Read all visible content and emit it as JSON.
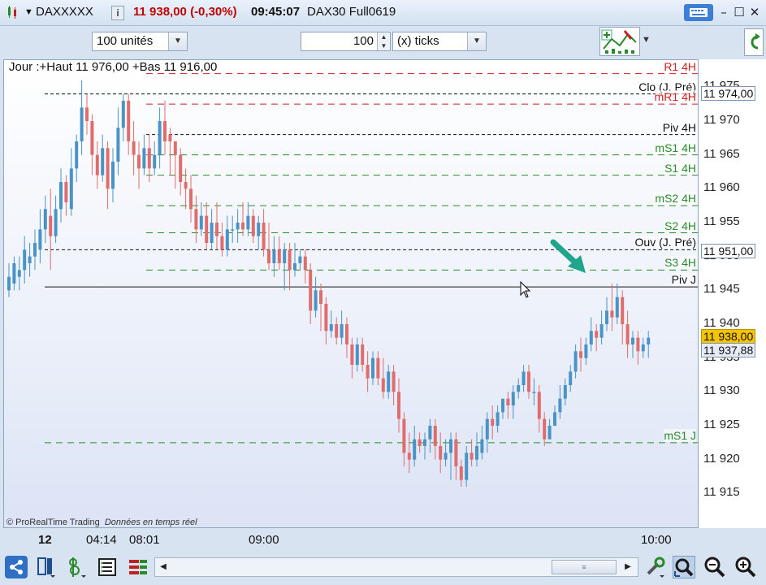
{
  "titlebar": {
    "ticker": "DAXXXXX",
    "info_icon": "info-icon",
    "price_change": "11 938,00 (-0,30%)",
    "time": "09:45:07",
    "contract": "DAX30 Full0619"
  },
  "toolbar": {
    "units_value": "100 unités",
    "quantity_value": "100",
    "ticks_value": "(x) ticks"
  },
  "chart": {
    "header": "Jour :+Haut 11 976,00 +Bas 11 916,00",
    "watermark_brand": "© ProRealTime Trading",
    "watermark_note": "Données en temps réel",
    "levels": [
      {
        "label": "R1 4H",
        "price": 11977.0,
        "color": "#d02020"
      },
      {
        "label": "Clo (J. Pré)",
        "price": 11974.0,
        "color": "#111111"
      },
      {
        "label": "mR1 4H",
        "price": 11972.5,
        "color": "#d02020"
      },
      {
        "label": "Piv 4H",
        "price": 11968.0,
        "color": "#111111"
      },
      {
        "label": "mS1 4H",
        "price": 11965.0,
        "color": "#2a8a2a"
      },
      {
        "label": "S1 4H",
        "price": 11962.0,
        "color": "#2a8a2a"
      },
      {
        "label": "mS2 4H",
        "price": 11957.5,
        "color": "#2a8a2a"
      },
      {
        "label": "S2 4H",
        "price": 11953.5,
        "color": "#2a8a2a"
      },
      {
        "label": "Ouv (J. Pré)",
        "price": 11951.0,
        "color": "#111111"
      },
      {
        "label": "S3 4H",
        "price": 11948.0,
        "color": "#2a8a2a"
      },
      {
        "label": "Piv J",
        "price": 11945.5,
        "color": "#111111"
      },
      {
        "label": "mS1 J",
        "price": 11922.5,
        "color": "#2a8a2a"
      }
    ]
  },
  "chart_data": {
    "type": "candlestick",
    "ylim": [
      11910,
      11979
    ],
    "yticks": [
      "11 975",
      "11 970",
      "11 965",
      "11 960",
      "11 955",
      "11 950",
      "11 945",
      "11 940",
      "11 935",
      "11 930",
      "11 925",
      "11 920",
      "11 915"
    ],
    "xticks": [
      "12",
      "04:14",
      "08:01",
      "09:00",
      "10:00"
    ],
    "candles": [
      [
        11945,
        11947,
        11944,
        11949
      ],
      [
        11946,
        11949,
        11945,
        11950
      ],
      [
        11947,
        11948,
        11945,
        11950
      ],
      [
        11948,
        11951,
        11946,
        11953
      ],
      [
        11949,
        11950,
        11947,
        11952
      ],
      [
        11950,
        11952,
        11948,
        11954
      ],
      [
        11951,
        11954,
        11949,
        11957
      ],
      [
        11954,
        11957,
        11952,
        11959
      ],
      [
        11956,
        11953,
        11948,
        11960
      ],
      [
        11953,
        11957,
        11952,
        11959
      ],
      [
        11957,
        11961,
        11955,
        11963
      ],
      [
        11961,
        11958,
        11956,
        11962
      ],
      [
        11957,
        11963,
        11956,
        11966
      ],
      [
        11963,
        11967,
        11961,
        11968
      ],
      [
        11967,
        11972,
        11965,
        11976
      ],
      [
        11972,
        11970,
        11968,
        11974
      ],
      [
        11970,
        11965,
        11962,
        11971
      ],
      [
        11965,
        11962,
        11960,
        11967
      ],
      [
        11962,
        11966,
        11961,
        11968
      ],
      [
        11966,
        11960,
        11957,
        11967
      ],
      [
        11960,
        11964,
        11958,
        11966
      ],
      [
        11964,
        11969,
        11962,
        11972
      ],
      [
        11969,
        11973,
        11967,
        11974
      ],
      [
        11973,
        11967,
        11965,
        11974
      ],
      [
        11967,
        11965,
        11962,
        11970
      ],
      [
        11965,
        11963,
        11960,
        11967
      ],
      [
        11963,
        11966,
        11962,
        11968
      ],
      [
        11966,
        11963,
        11961,
        11968
      ],
      [
        11963,
        11965,
        11962,
        11967
      ],
      [
        11965,
        11970,
        11963,
        11972
      ],
      [
        11970,
        11967,
        11965,
        11973
      ],
      [
        11968,
        11967,
        11962,
        11969
      ],
      [
        11967,
        11965,
        11960,
        11967
      ],
      [
        11965,
        11961,
        11959,
        11966
      ],
      [
        11961,
        11960,
        11957,
        11963
      ],
      [
        11960,
        11957,
        11955,
        11962
      ],
      [
        11957,
        11954,
        11952,
        11959
      ],
      [
        11954,
        11956,
        11953,
        11958
      ],
      [
        11956,
        11952,
        11951,
        11958
      ],
      [
        11952,
        11955,
        11951,
        11957
      ],
      [
        11955,
        11953,
        11951,
        11958
      ],
      [
        11953,
        11951,
        11950,
        11955
      ],
      [
        11951,
        11954,
        11950,
        11956
      ],
      [
        11954,
        11954,
        11952,
        11956
      ],
      [
        11954,
        11955,
        11952,
        11957
      ],
      [
        11955,
        11954,
        11953,
        11958
      ],
      [
        11954,
        11956,
        11953,
        11958
      ],
      [
        11956,
        11953,
        11952,
        11957
      ],
      [
        11953,
        11955,
        11951,
        11956
      ],
      [
        11955,
        11951,
        11950,
        11957
      ],
      [
        11951,
        11949,
        11948,
        11955
      ],
      [
        11949,
        11951,
        11947,
        11953
      ],
      [
        11951,
        11949,
        11948,
        11953
      ],
      [
        11949,
        11951,
        11945,
        11952
      ],
      [
        11951,
        11948,
        11945,
        11952
      ],
      [
        11948,
        11949,
        11947,
        11952
      ],
      [
        11949,
        11950,
        11948,
        11951
      ],
      [
        11950,
        11948,
        11946,
        11951
      ],
      [
        11948,
        11942,
        11940,
        11949
      ],
      [
        11942,
        11945,
        11941,
        11947
      ],
      [
        11945,
        11943,
        11939,
        11946
      ],
      [
        11943,
        11939,
        11937,
        11944
      ],
      [
        11939,
        11940,
        11938,
        11942
      ],
      [
        11940,
        11938,
        11937,
        11941
      ],
      [
        11938,
        11940,
        11937,
        11942
      ],
      [
        11940,
        11937,
        11935,
        11941
      ],
      [
        11937,
        11934,
        11932,
        11938
      ],
      [
        11934,
        11937,
        11933,
        11938
      ],
      [
        11937,
        11934,
        11933,
        11938
      ],
      [
        11934,
        11932,
        11930,
        11936
      ],
      [
        11932,
        11935,
        11931,
        11936
      ],
      [
        11935,
        11932,
        11931,
        11936
      ],
      [
        11932,
        11930,
        11929,
        11935
      ],
      [
        11930,
        11933,
        11929,
        11934
      ],
      [
        11933,
        11930,
        11928,
        11934
      ],
      [
        11930,
        11926,
        11924,
        11932
      ],
      [
        11926,
        11921,
        11919,
        11927
      ],
      [
        11921,
        11920,
        11918,
        11924
      ],
      [
        11920,
        11923,
        11919,
        11925
      ],
      [
        11923,
        11922,
        11921,
        11924
      ],
      [
        11922,
        11923,
        11920,
        11924
      ],
      [
        11923,
        11925,
        11921,
        11926
      ],
      [
        11925,
        11922,
        11920,
        11926
      ],
      [
        11922,
        11920,
        11918,
        11924
      ],
      [
        11920,
        11921,
        11919,
        11923
      ],
      [
        11921,
        11923,
        11917,
        11924
      ],
      [
        11923,
        11919,
        11917,
        11924
      ],
      [
        11919,
        11917,
        11916,
        11920
      ],
      [
        11917,
        11921,
        11916,
        11922
      ],
      [
        11921,
        11920,
        11919,
        11923
      ],
      [
        11920,
        11922,
        11919,
        11924
      ],
      [
        11921,
        11923,
        11920,
        11925
      ],
      [
        11923,
        11926,
        11921,
        11927
      ],
      [
        11926,
        11925,
        11923,
        11928
      ],
      [
        11925,
        11927,
        11924,
        11928
      ],
      [
        11927,
        11929,
        11926,
        11929
      ],
      [
        11929,
        11928,
        11926,
        11930
      ],
      [
        11928,
        11930,
        11926,
        11931
      ],
      [
        11930,
        11931,
        11929,
        11932
      ],
      [
        11931,
        11933,
        11930,
        11934
      ],
      [
        11933,
        11930,
        11929,
        11934
      ],
      [
        11930,
        11930,
        11928,
        11932
      ],
      [
        11930,
        11926,
        11924,
        11931
      ],
      [
        11926,
        11923,
        11922,
        11927
      ],
      [
        11923,
        11925,
        11923,
        11926
      ],
      [
        11925,
        11927,
        11925,
        11928
      ],
      [
        11927,
        11929,
        11926,
        11931
      ],
      [
        11929,
        11931,
        11928,
        11932
      ],
      [
        11931,
        11933,
        11930,
        11934
      ],
      [
        11933,
        11936,
        11932,
        11937
      ],
      [
        11936,
        11935,
        11933,
        11938
      ],
      [
        11935,
        11937,
        11934,
        11938
      ],
      [
        11937,
        11939,
        11936,
        11941
      ],
      [
        11939,
        11938,
        11936,
        11940
      ],
      [
        11938,
        11940,
        11937,
        11942
      ],
      [
        11940,
        11942,
        11939,
        11944
      ],
      [
        11942,
        11941,
        11939,
        11946
      ],
      [
        11941,
        11944,
        11940,
        11946
      ],
      [
        11944,
        11940,
        11937,
        11945
      ],
      [
        11940,
        11937,
        11935,
        11942
      ],
      [
        11937,
        11938,
        11935,
        11939
      ],
      [
        11938,
        11936,
        11934,
        11939
      ],
      [
        11936,
        11937,
        11935,
        11938
      ],
      [
        11937,
        11938,
        11935,
        11939
      ]
    ],
    "current_price_label": "11 938,00",
    "last_price_label": "11 937,88",
    "clo_price_label": "11 974,00",
    "ouv_price_label": "11 951,00",
    "up_color": "#4a93c7",
    "down_color": "#e06c6c"
  },
  "bottom_icons": [
    "share-icon",
    "display-icon",
    "indicator-icon",
    "list-icon",
    "drawing-icon",
    "scroll-left-icon",
    "scroll-right-icon",
    "tools-icon",
    "zoom-select-icon",
    "zoom-out-icon",
    "zoom-in-icon"
  ]
}
